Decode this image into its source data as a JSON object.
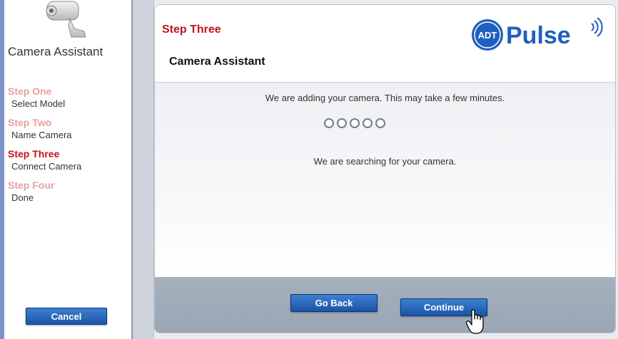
{
  "sidebar": {
    "title": "Camera Assistant",
    "steps": [
      {
        "title": "Step One",
        "subtitle": "Select Model",
        "active": false
      },
      {
        "title": "Step Two",
        "subtitle": "Name Camera",
        "active": false
      },
      {
        "title": "Step Three",
        "subtitle": "Connect Camera",
        "active": true
      },
      {
        "title": "Step Four",
        "subtitle": "Done",
        "active": false
      }
    ],
    "cancel_label": "Cancel"
  },
  "header": {
    "step_label": "Step Three",
    "title": "Camera Assistant",
    "logo_badge": "ADT",
    "logo_text": "Pulse"
  },
  "content": {
    "adding_message": "We are adding your camera. This may take a few minutes.",
    "progress_dots": 5,
    "search_message": "We are searching for your camera."
  },
  "footer": {
    "go_back_label": "Go Back",
    "continue_label": "Continue"
  },
  "colors": {
    "accent_red": "#c0141c",
    "inactive_step": "#e8a0a0",
    "button_blue": "#1d56a8",
    "logo_blue": "#1f5fbf"
  }
}
